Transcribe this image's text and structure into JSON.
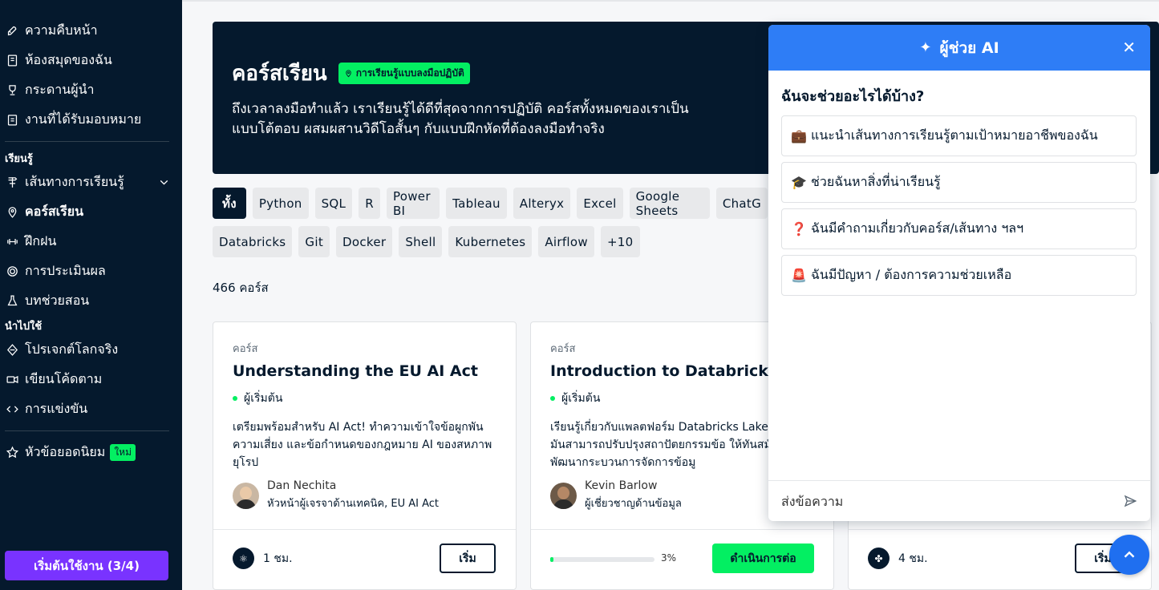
{
  "sidebar": {
    "items_top": [
      {
        "label": "ความคืบหน้า",
        "icon": "rocket-icon"
      },
      {
        "label": "ห้องสมุดของฉัน",
        "icon": "book-icon"
      },
      {
        "label": "กระดานผู้นำ",
        "icon": "trophy-icon"
      },
      {
        "label": "งานที่ได้รับมอบหมาย",
        "icon": "clipboard-icon"
      }
    ],
    "section_learn": "เรียนรู้",
    "items_learn": [
      {
        "label": "เส้นทางการเรียนรู้",
        "icon": "path-icon"
      },
      {
        "label": "คอร์สเรียน",
        "icon": "location-pin-icon"
      },
      {
        "label": "ฝึกฝน",
        "icon": "dumbbell-icon"
      },
      {
        "label": "การประเมินผล",
        "icon": "target-icon"
      },
      {
        "label": "บทช่วยสอน",
        "icon": "flask-icon"
      }
    ],
    "section_apply": "นำไปใช้",
    "items_apply": [
      {
        "label": "โปรเจกต์โลกจริง",
        "icon": "cube-icon"
      },
      {
        "label": "เขียนโค้ดตาม",
        "icon": "video-icon"
      },
      {
        "label": "การแข่งขัน",
        "icon": "code-icon"
      }
    ],
    "featured": {
      "label": "หัวข้อยอดนิยม",
      "badge": "ใหม่",
      "icon": "star-icon"
    },
    "start_button": "เริ่มต้นใช้งาน (3/4)"
  },
  "hero": {
    "title": "คอร์สเรียน",
    "badge": "การเรียนรู้แบบลงมือปฏิบัติ",
    "description": "ถึงเวลาลงมือทำแล้ว เราเรียนรู้ได้ดีที่สุดจากการปฏิบัติ คอร์สทั้งหมดของเราเป็นแบบโต้ตอบ ผสมผสานวิดีโอสั้นๆ กับแบบฝึกหัดที่ต้องลงมือทำจริง"
  },
  "filters": {
    "row1": [
      "ทั้ง",
      "Python",
      "SQL",
      "R",
      "Power BI",
      "Tableau",
      "Alteryx",
      "Excel",
      "Google Sheets",
      "ChatG"
    ],
    "row2": [
      "Databricks",
      "Git",
      "Docker",
      "Shell",
      "Kubernetes",
      "Airflow",
      "+10"
    ]
  },
  "course_count": "466 คอร์ส",
  "cards": [
    {
      "kind": "คอร์ส",
      "title": "Understanding the EU AI Act",
      "level": "ผู้เริ่มต้น",
      "description": "เตรียมพร้อมสำหรับ AI Act! ทำความเข้าใจข้อผูกพัน ความเสี่ยง และข้อกำหนดของกฎหมาย AI ของสหภาพยุโรป",
      "author_name": "Dan Nechita",
      "author_role": "หัวหน้าผู้เจรจาด้านเทคนิค, EU AI Act",
      "duration": "1 ชม.",
      "action": "เริ่ม"
    },
    {
      "kind": "คอร์ส",
      "title": "Introduction to Databricks",
      "level": "ผู้เริ่มต้น",
      "description": "เรียนรู้เกี่ยวกับแพลตฟอร์ม Databricks Lake และวิธีที่มันสามารถปรับปรุงสถาปัตยกรรมข้อ ให้ทันสมัยและพัฒนากระบวนการจัดการข้อมู",
      "author_name": "Kevin Barlow",
      "author_role": "ผู้เชี่ยวชาญด้านข้อมูล",
      "progress": 0.03,
      "progress_label": "3%",
      "action": "ดำเนินการต่อ"
    },
    {
      "duration": "4 ชม.",
      "action": "เริ่ม"
    }
  ],
  "ai_panel": {
    "title": "ผู้ช่วย AI",
    "question": "ฉันจะช่วยอะไรได้บ้าง?",
    "options": [
      {
        "emoji": "💼",
        "label": "แนะนำเส้นทางการเรียนรู้ตามเป้าหมายอาชีพของฉัน"
      },
      {
        "emoji": "🎓",
        "label": "ช่วยฉันหาสิ่งที่น่าเรียนรู้"
      },
      {
        "emoji": "❓",
        "label": "ฉันมีคำถามเกี่ยวกับคอร์ส/เส้นทาง ฯลฯ"
      },
      {
        "emoji": "🚨",
        "label": "ฉันมีปัญหา / ต้องการความช่วยเหลือ"
      }
    ],
    "input_placeholder": "ส่งข้อความ"
  },
  "colors": {
    "navy": "#05192d",
    "green": "#03ef62",
    "purple": "#7933ff",
    "blue": "#2e7df6"
  }
}
